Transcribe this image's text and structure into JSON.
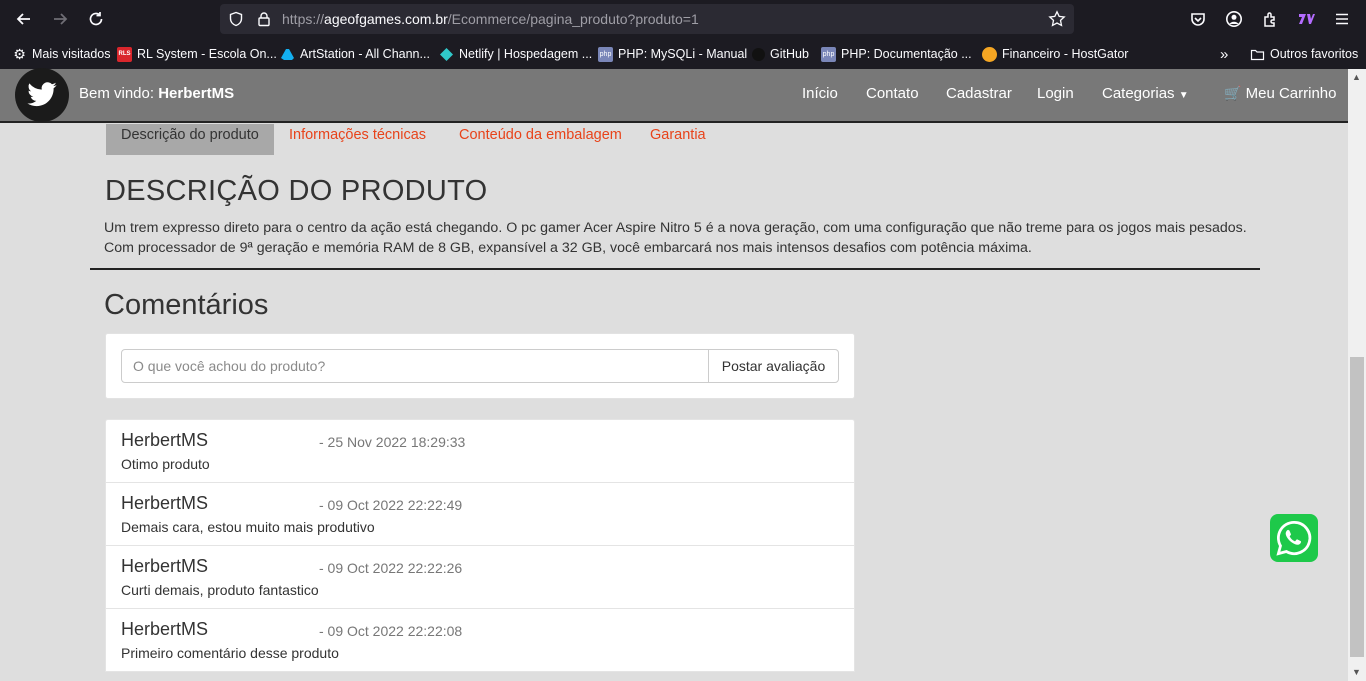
{
  "browser": {
    "url_prefix": "https://",
    "url_host": "ageofgames.com.br",
    "url_path": "/Ecommerce/pagina_produto?produto=1",
    "bookmarks": [
      {
        "label": "Mais visitados",
        "icon": "gear-icon"
      },
      {
        "label": "RL System - Escola On...",
        "icon": "rls-icon"
      },
      {
        "label": "ArtStation - All Chann...",
        "icon": "artstation-icon"
      },
      {
        "label": "Netlify | Hospedagem ...",
        "icon": "netlify-icon"
      },
      {
        "label": "PHP: MySQLi - Manual",
        "icon": "php-icon"
      },
      {
        "label": "GitHub",
        "icon": "github-icon"
      },
      {
        "label": "PHP: Documentação ...",
        "icon": "php-icon"
      },
      {
        "label": "Financeiro - HostGator",
        "icon": "hostgator-icon"
      }
    ],
    "other_bookmarks": "Outros favoritos"
  },
  "navbar": {
    "welcome_prefix": "Bem vindo:",
    "username": "HerbertMS",
    "links": [
      "Início",
      "Contato",
      "Cadastrar",
      "Login",
      "Categorias"
    ],
    "cart": "Meu Carrinho"
  },
  "tabs": [
    "Descrição do produto",
    "Informações técnicas",
    "Conteúdo da embalagem",
    "Garantia"
  ],
  "description": {
    "title": "DESCRIÇÃO DO PRODUTO",
    "text": "Um trem expresso direto para o centro da ação está chegando. O pc gamer Acer Aspire Nitro 5 é a nova geração, com uma configuração que não treme para os jogos mais pesados. Com processador de 9ª geração e memória RAM de 8 GB, expansível a 32 GB, você embarcará nos mais intensos desafios com potência máxima."
  },
  "comments": {
    "title": "Comentários",
    "placeholder": "O que você achou do produto?",
    "post_button": "Postar avaliação",
    "items": [
      {
        "author": "HerbertMS",
        "date": "- 25 Nov 2022 18:29:33",
        "text": "Otimo produto"
      },
      {
        "author": "HerbertMS",
        "date": "- 09 Oct 2022 22:22:49",
        "text": "Demais cara, estou muito mais produtivo"
      },
      {
        "author": "HerbertMS",
        "date": "- 09 Oct 2022 22:22:26",
        "text": "Curti demais, produto fantastico"
      },
      {
        "author": "HerbertMS",
        "date": "- 09 Oct 2022 22:22:08",
        "text": "Primeiro comentário desse produto"
      }
    ]
  },
  "colors": {
    "accent_link": "#e8431a",
    "navbar": "#787878",
    "whatsapp": "#1ec94a"
  }
}
